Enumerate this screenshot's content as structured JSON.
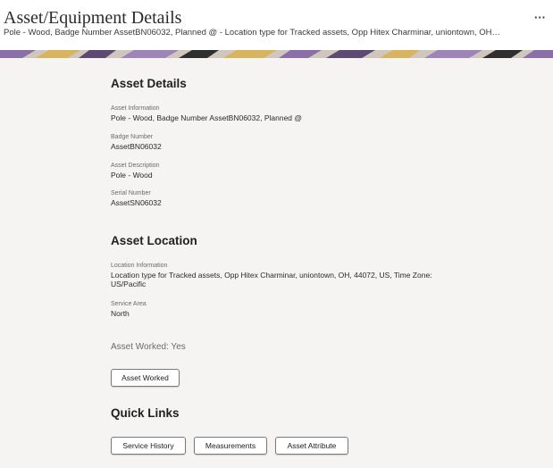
{
  "header": {
    "title": "Asset/Equipment Details",
    "subtitle": "Pole - Wood, Badge Number AssetBN06032, Planned @ - Location type for Tracked assets, Opp Hitex Charminar, uniontown, OH…",
    "more_label": "···"
  },
  "asset_details": {
    "title": "Asset Details",
    "fields": [
      {
        "label": "Asset Information",
        "value": "Pole - Wood, Badge Number AssetBN06032, Planned @"
      },
      {
        "label": "Badge Number",
        "value": "AssetBN06032"
      },
      {
        "label": "Asset Description",
        "value": "Pole - Wood"
      },
      {
        "label": "Serial Number",
        "value": "AssetSN06032"
      }
    ]
  },
  "asset_location": {
    "title": "Asset Location",
    "fields": [
      {
        "label": "Location Information",
        "value": "Location type for Tracked assets, Opp Hitex Charminar, uniontown, OH, 44072, US, Time Zone: US/Pacific"
      },
      {
        "label": "Service Area",
        "value": "North"
      }
    ],
    "worked_status": "Asset Worked: Yes",
    "worked_button": "Asset Worked"
  },
  "quick_links": {
    "title": "Quick Links",
    "buttons": [
      "Service History",
      "Measurements",
      "Asset Attribute"
    ]
  },
  "colors": {
    "background": "#f5f4f2",
    "header_bg": "#ffffff",
    "banner_purple": "#8a6fa8",
    "banner_gold": "#d8b45e"
  }
}
